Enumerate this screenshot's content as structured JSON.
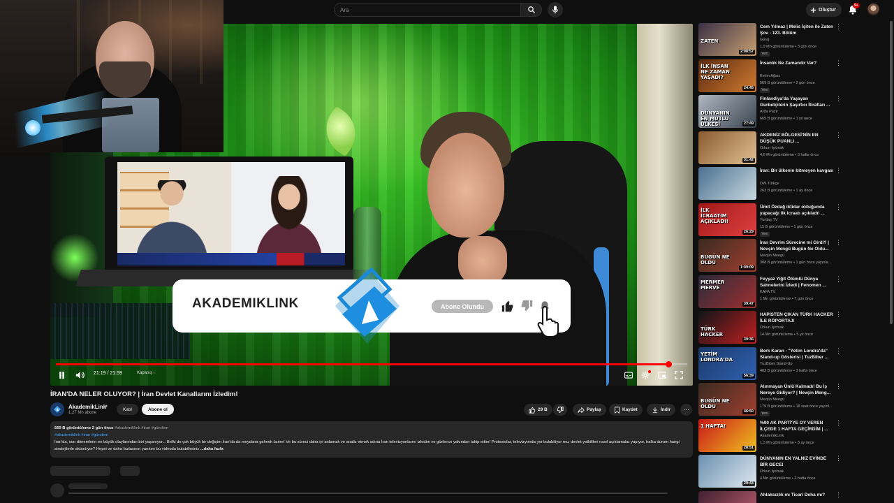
{
  "search": {
    "placeholder": "Ara"
  },
  "header": {
    "create_label": "Oluştur",
    "notif_count": "9+"
  },
  "player": {
    "time": "21:19 / 21:59",
    "chapter": "Kapanış ›",
    "progress": 0.97,
    "overlay": {
      "brand": "AKADEMIKLINK",
      "subscribed_label": "Abone Olundu"
    }
  },
  "video": {
    "title": "İRAN'DA NELER OLUYOR? | İran Devlet Kanallarını İzledim!",
    "channel": "AkademikLink",
    "subs": "1,27 Mn abone",
    "join_label": "Katıl",
    "subscribe_label": "Abone ol",
    "likes": "29 B",
    "share_label": "Paylaş",
    "save_label": "Kaydet",
    "download_label": "İndir"
  },
  "description": {
    "meta": "569 B görüntüleme  2 gün önce",
    "meta_tags": "#akademiklink #iran #gündem",
    "tags": "#akademiklink #iran #gündem",
    "body": "İran'da, son dönemlerin en büyük olaylarından biri yaşanıyor...  Belki de çok büyük bir değişim İran'da da meydana gelmek üzere! Ve bu süreci daha iyi anlamak ve analiz etmek adına İran televizyonlarını izledim ve günlerce yakından takip ettim! Protestolar, televizyonda yer bulabiliyor mu, devlet yetkilileri nasıl açıklamalar yapıyor, halka durum hangi stratejilerle aktarılıyor? Hepsi ve daha fazlasının yanıtını bu videoda bulabilirsiniz",
    "more": "...daha fazla"
  },
  "sidebar": {
    "items": [
      {
        "title": "Cem Yılmaz | Melis İşiten ile Zaten Şov - 123. Bölüm",
        "channel": "Garaj",
        "meta": "1,9 Mn görüntüleme • 3 gün önce",
        "badge": "Yeni",
        "duration": "2:08:57",
        "thumb_text": "ZATEN",
        "colors": [
          "#3a3046",
          "#c8a070"
        ]
      },
      {
        "title": "İnsanlık Ne Zamandır Var?",
        "channel": "Evrim Ağacı",
        "meta": "569 B görüntüleme • 2 gün önce",
        "badge": "Yeni",
        "duration": "24:45",
        "thumb_text": "İLK İNSAN NE ZAMAN YAŞADI?",
        "colors": [
          "#5a2a10",
          "#d07a30"
        ]
      },
      {
        "title": "Finlandiya'da Yaşayan Gurbetçilerin Şaşırtıcı İtirafları ...",
        "channel": "Arda Pazır",
        "meta": "665 B görüntüleme • 1 yıl önce",
        "badge": "",
        "duration": "27:49",
        "thumb_text": "DÜNYANIN EN MUTLU ÜLKESİ",
        "colors": [
          "#b0b8c0",
          "#3a4450"
        ]
      },
      {
        "title": "AKDENİZ BÖLGESİ'NİN EN DÜŞÜK PUANLI ...",
        "channel": "Orkun Işıtmak",
        "meta": "4,6 Mn görüntüleme • 3 hafta önce",
        "badge": "",
        "duration": "31:42",
        "thumb_text": "",
        "colors": [
          "#8a5a30",
          "#e0c090"
        ]
      },
      {
        "title": "İran: Bir ülkenin bitmeyen kavgası",
        "channel": "DW Türkçe",
        "meta": "263 B görüntüleme • 1 ay önce",
        "badge": "",
        "duration": "",
        "thumb_text": "",
        "colors": [
          "#4a7090",
          "#c8d8e0"
        ]
      },
      {
        "title": "Ümit Özdağ iktidar olduğunda yapacağı ilk icraatı açıkladı! ...",
        "channel": "Yurttaş TV",
        "meta": "15 B görüntüleme • 1 gün önce",
        "badge": "Yeni",
        "duration": "26:29",
        "thumb_text": "İLK İCRAATIM AÇIKLADI!",
        "colors": [
          "#a01818",
          "#e04040"
        ]
      },
      {
        "title": "İran Devrim Sürecine mi Girdi? | Nevşin Mengü Bugün Ne Oldu...",
        "channel": "Nevşin Mengü",
        "meta": "308 B görüntüleme • 1 gün önce yayınla...",
        "badge": "",
        "duration": "1:09:09",
        "thumb_text": "BUGÜN NE OLDU",
        "colors": [
          "#3a2a20",
          "#a04030"
        ]
      },
      {
        "title": "Feyyaz Yiğit Ölümlü Dünya Sahnelerini İzledi | Fenomen ...",
        "channel": "KAFA TV",
        "meta": "1 Mn görüntüleme • 7 gün önce",
        "badge": "",
        "duration": "39:47",
        "thumb_text": "MERMER MERVE",
        "colors": [
          "#2a2a3a",
          "#a03030"
        ]
      },
      {
        "title": "HAPİSTEN ÇIKAN TÜRK HACKER İLE RÖPORTAJ!",
        "channel": "Orkun Işıtmak",
        "meta": "14 Mn görüntüleme • 5 yıl önce",
        "badge": "",
        "duration": "39:36",
        "thumb_text": "TÜRK HACKER",
        "colors": [
          "#101418",
          "#c02020"
        ]
      },
      {
        "title": "Berk Karan - \"Yetim Londra'da\" Stand-up Gösterisi | TuzBiber ...",
        "channel": "TuzBiber Stand-Up",
        "meta": "403 B görüntüleme • 3 hafta önce",
        "badge": "",
        "duration": "56:39",
        "thumb_text": "YETİM LONDRA'DA",
        "colors": [
          "#1a3a6a",
          "#3060b0"
        ]
      },
      {
        "title": "Alınmayan Ünlü Kalmadı! Bu İş Nereye Gidiyor? | Nevşin Meng...",
        "channel": "Nevşin Mengü",
        "meta": "179 B görüntüleme • 18 saat önce yayınl...",
        "badge": "Yeni",
        "duration": "46:50",
        "thumb_text": "BUGÜN NE OLDU",
        "colors": [
          "#3a2a20",
          "#a04030"
        ]
      },
      {
        "title": "%90 AK PARTİ'YE OY VEREN İLÇEDE 1 HAFTA GEÇİRDİM | ...",
        "channel": "AkademikLink",
        "meta": "1,3 Mn görüntüleme • 3 ay önce",
        "badge": "",
        "duration": "28:51",
        "thumb_text": "1 HAFTA!",
        "colors": [
          "#c81818",
          "#f0c020"
        ]
      },
      {
        "title": "DÜNYANIN EN YALNIZ EVİNDE BİR GECE!",
        "channel": "Orkun Işıtmak",
        "meta": "4 Mn görüntüleme • 2 hafta önce",
        "badge": "",
        "duration": "29:43",
        "thumb_text": "",
        "colors": [
          "#6a90b0",
          "#e0e8f0"
        ]
      },
      {
        "title": "Ahlaksızlık mı Ticari Deha mı?",
        "channel": "",
        "meta": "",
        "badge": "",
        "duration": "",
        "thumb_text": "",
        "colors": [
          "#402030",
          "#c06070"
        ]
      }
    ]
  }
}
